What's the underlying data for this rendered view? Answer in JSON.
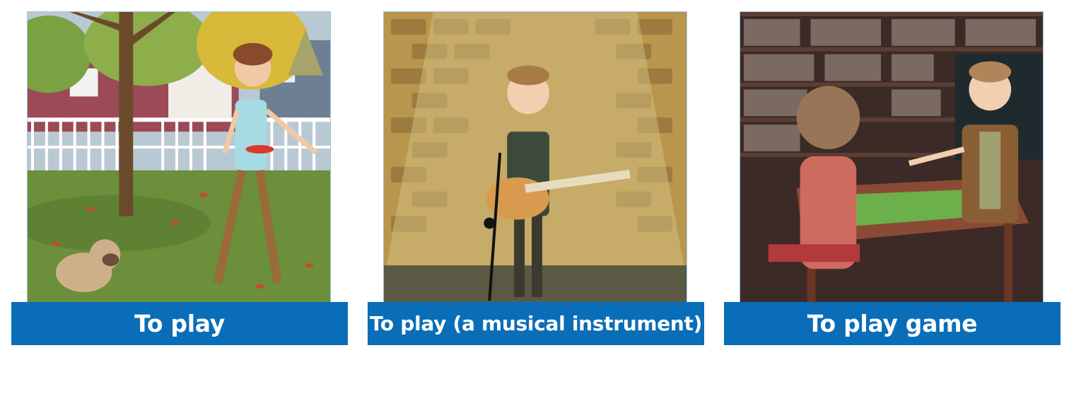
{
  "cards": [
    {
      "caption": "To play",
      "scene_icon": "frisbee-park-scene-icon"
    },
    {
      "caption": "To play (a musical instrument)",
      "scene_icon": "guitar-singer-scene-icon"
    },
    {
      "caption": "To play game",
      "scene_icon": "board-game-library-scene-icon"
    }
  ],
  "colors": {
    "caption_bg": "#0a6db7",
    "caption_text": "#ffffff"
  }
}
